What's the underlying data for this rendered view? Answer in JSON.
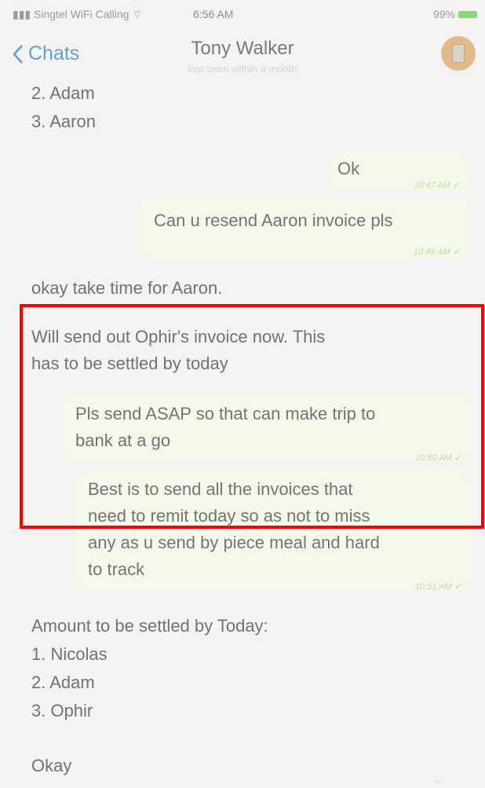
{
  "status_bar": {
    "carrier": "Singtel WiFi Calling",
    "time": "6:56 AM",
    "battery": "99%"
  },
  "nav": {
    "back_label": "Chats",
    "contact_name": "Tony Walker",
    "subtitle": "last seen within a month"
  },
  "messages": {
    "top_list": [
      "2. Adam",
      "3. Aaron"
    ],
    "ok": {
      "text": "Ok",
      "time": "10:47 AM"
    },
    "resend": {
      "text": "Can u resend Aaron invoice pls",
      "time": "10:48 AM"
    },
    "incoming_1": "okay take time for Aaron.",
    "incoming_2_line1": "Will send out Ophir's invoice now. This",
    "incoming_2_line2": "has to be settled by today",
    "asap": {
      "line1": "Pls send ASAP so that can make trip to",
      "line2": "bank at a go",
      "time": "10:50 AM"
    },
    "best": {
      "line1": "Best is to send all the invoices that",
      "line2": "need to remit today so as not to miss",
      "line3": "any as u send by piece meal and hard",
      "line4": "to track",
      "time": "10:51 AM"
    },
    "amount_heading": "Amount to be settled by Today:",
    "amount_list": [
      "1. Nicolas",
      "2. Adam",
      "3. Ophir"
    ],
    "okay": "Okay"
  }
}
